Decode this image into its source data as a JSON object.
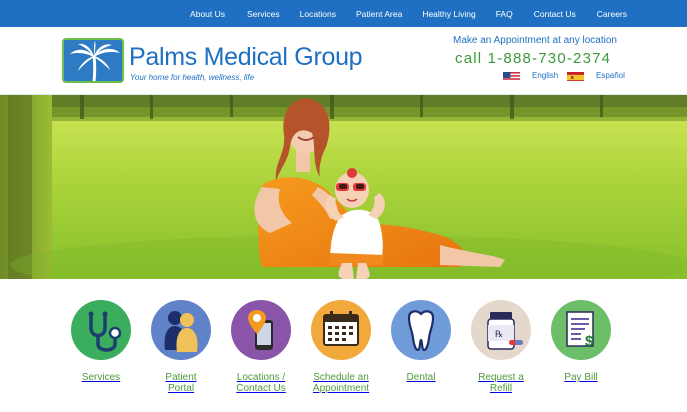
{
  "nav": {
    "items": [
      "About Us",
      "Services",
      "Locations",
      "Patient Area",
      "Healthy Living",
      "FAQ",
      "Contact Us",
      "Careers"
    ]
  },
  "header": {
    "brand_name": "Palms Medical Group",
    "tagline": "Your home for health, wellness, life",
    "appointment_text": "Make an Appointment at any location",
    "phone_text": "call 1-888-730-2374",
    "languages": [
      {
        "label": "English",
        "flag": "us-flag-icon"
      },
      {
        "label": "Español",
        "flag": "spain-flag-icon"
      }
    ]
  },
  "hero": {
    "image": "mother-and-baby-in-grass-photo"
  },
  "services": [
    {
      "label": "Services",
      "icon": "stethoscope-icon",
      "color": "#3aae5c"
    },
    {
      "label": "Patient\nPortal",
      "icon": "people-icon",
      "color": "#5f82c8"
    },
    {
      "label": "Locations /\nContact Us",
      "icon": "phone-location-icon",
      "color": "#8a54a8"
    },
    {
      "label": "Schedule an\nAppointment",
      "icon": "calendar-icon",
      "color": "#f0a93a"
    },
    {
      "label": "Dental",
      "icon": "tooth-icon",
      "color": "#6f9bd8"
    },
    {
      "label": "Request a\nRefill",
      "icon": "pill-bottle-icon",
      "color": "#e4d8cc"
    },
    {
      "label": "Pay Bill",
      "icon": "bill-icon",
      "color": "#6dbe68"
    }
  ],
  "colors": {
    "nav_bg": "#1f6fc2",
    "brand_blue": "#1f6fc2",
    "phone_green": "#3a9a3a",
    "label_green": "#4f9a3c"
  }
}
